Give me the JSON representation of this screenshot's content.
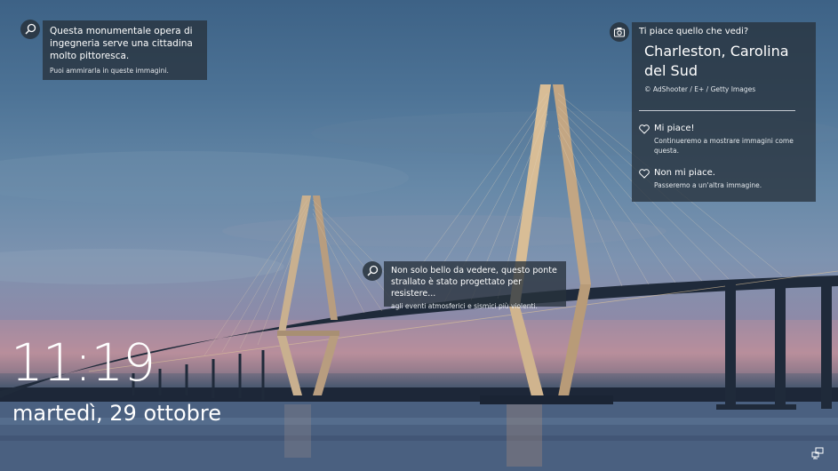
{
  "hints": [
    {
      "title": "Questa monumentale opera di ingegneria serve una cittadina molto pittoresca.",
      "subtitle": "Puoi ammirarla in queste immagini.",
      "icon": "search-icon"
    },
    {
      "title": "Non solo bello da vedere, questo ponte strallato è stato progettato per resistere...",
      "subtitle": "agli eventi atmosferici e sismici più violenti.",
      "icon": "search-icon"
    }
  ],
  "spotlight": {
    "question": "Ti piace quello che vedi?",
    "location": "Charleston, Carolina del Sud",
    "credit": "© AdShooter / E+ / Getty Images",
    "like_label": "Mi piace!",
    "like_desc": "Continueremo a mostrare immagini come questa.",
    "dislike_label": "Non mi piace.",
    "dislike_desc": "Passeremo a un'altra immagine.",
    "icon": "camera-icon"
  },
  "clock": {
    "time": "11:19",
    "date": "martedì, 29 ottobre"
  },
  "tray": {
    "network_icon": "network-icon"
  }
}
